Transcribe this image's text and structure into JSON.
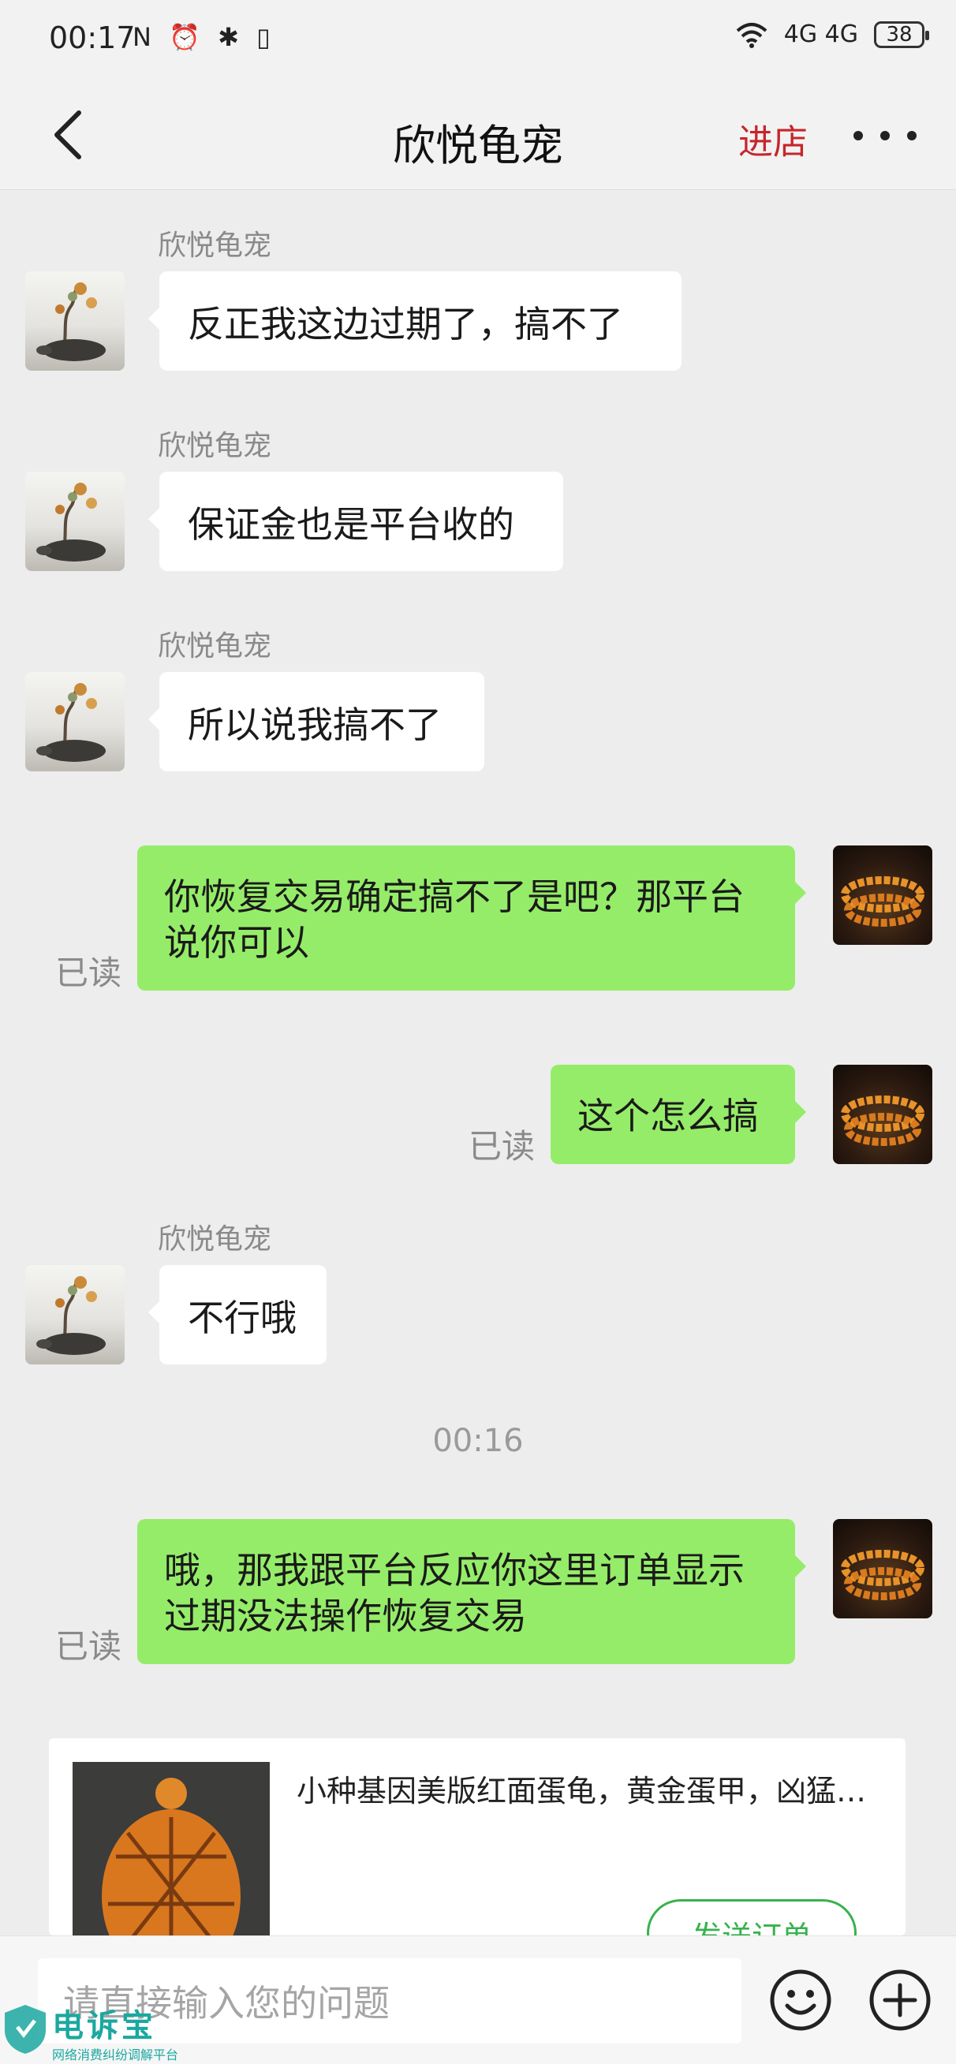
{
  "status_bar": {
    "time": "00:17",
    "left_icons": "N ⏰ ✱ ▯",
    "network": "4G 4G",
    "battery": "38"
  },
  "header": {
    "title": "欣悦龟宠",
    "enter_store": "进店"
  },
  "messages": [
    {
      "sender": "欣悦龟宠",
      "text": "反正我这边过期了，搞不了"
    },
    {
      "sender": "欣悦龟宠",
      "text": "保证金也是平台收的"
    },
    {
      "sender": "欣悦龟宠",
      "text": "所以说我搞不了"
    },
    {
      "text": "你恢复交易确定搞不了是吧？那平台说你可以",
      "status": "已读"
    },
    {
      "text": "这个怎么搞",
      "status": "已读"
    },
    {
      "sender": "欣悦龟宠",
      "text": "不行哦"
    },
    {
      "time": "00:16"
    },
    {
      "text": "哦，那我跟平台反应你这里订单显示过期没法操作恢复交易",
      "status": "已读"
    }
  ],
  "product_card": {
    "title": "小种基因美版红面蛋龟，黄金蛋甲，凶猛…",
    "send_order": "发送订单"
  },
  "input": {
    "placeholder": "请直接输入您的问题"
  },
  "watermark": {
    "text": "电诉宝",
    "subtext": "网络消费纠纷调解平台"
  },
  "colors": {
    "outgoing_bubble": "#95ec69",
    "incoming_bubble": "#ffffff",
    "store_link": "#c5262c",
    "accent_green": "#37b24d"
  }
}
